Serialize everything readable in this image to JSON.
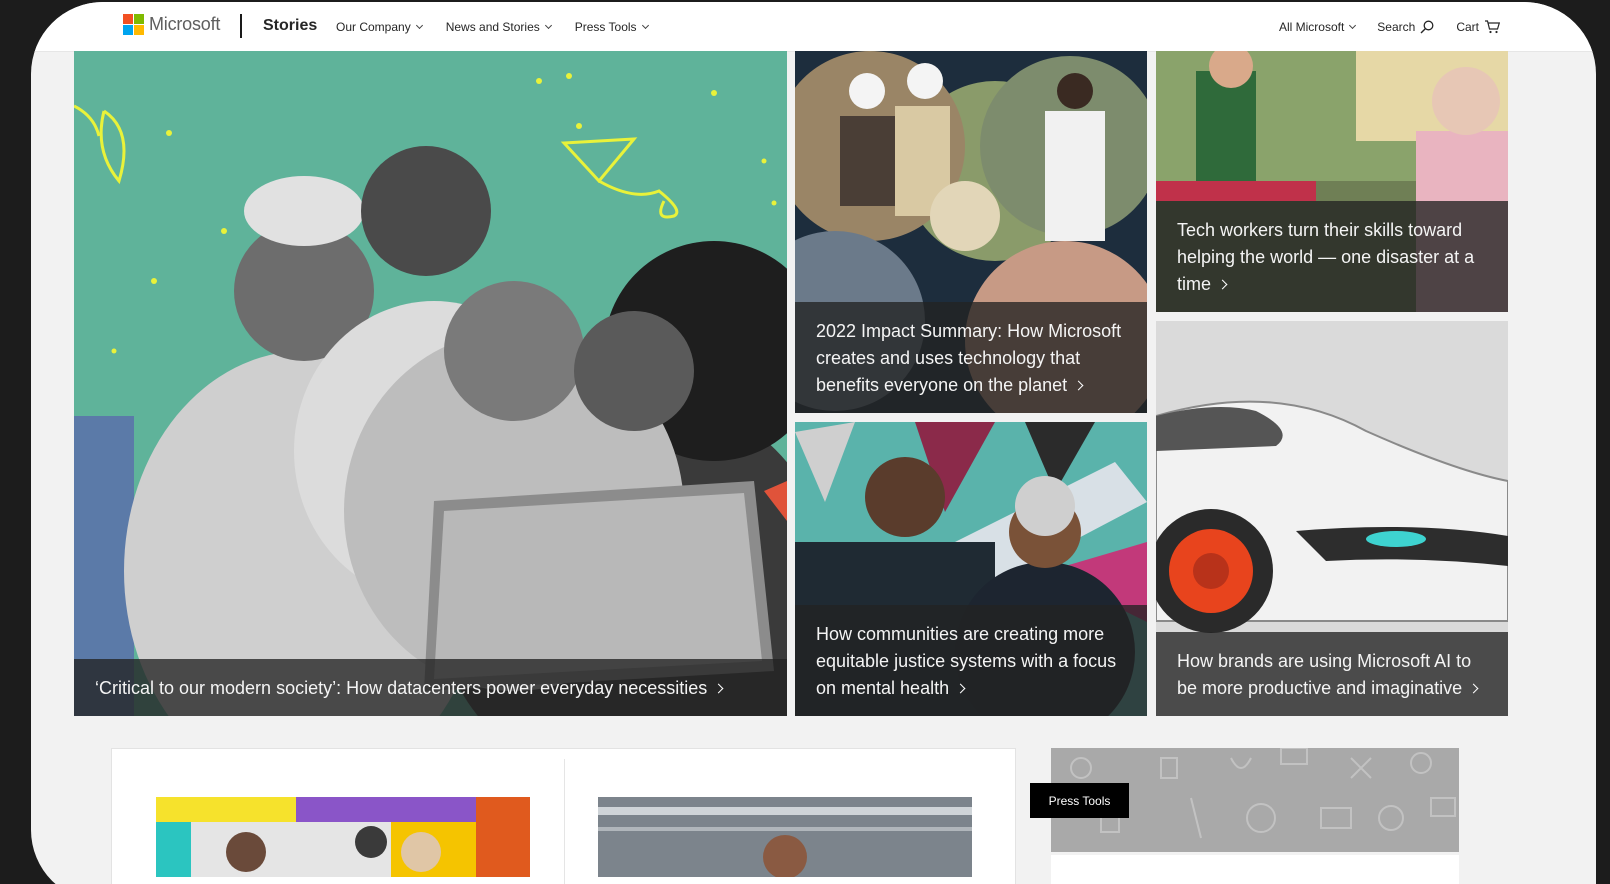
{
  "header": {
    "logo_text": "Microsoft",
    "section_title": "Stories",
    "nav": [
      "Our Company",
      "News and Stories",
      "Press Tools"
    ],
    "right": {
      "all_microsoft": "All Microsoft",
      "search": "Search",
      "cart": "Cart"
    }
  },
  "colors": {
    "ms_red": "#f25022",
    "ms_green": "#7fba00",
    "ms_blue": "#00a4ef",
    "ms_yellow": "#ffb900"
  },
  "hero": {
    "tiles": [
      {
        "caption": "‘Critical to our modern society’: How datacenters power everyday necessities"
      },
      {
        "caption": "2022 Impact Summary: How Microsoft creates and uses technology that benefits everyone on the planet"
      },
      {
        "caption": "Tech workers turn their skills toward helping the world — one disaster at a time"
      },
      {
        "caption": "How communities are creating more equitable justice systems with a focus on mental health"
      },
      {
        "caption": "How brands are using Microsoft AI to be more productive and imaginative"
      }
    ]
  },
  "lower": {
    "press_tools_button": "Press Tools"
  }
}
